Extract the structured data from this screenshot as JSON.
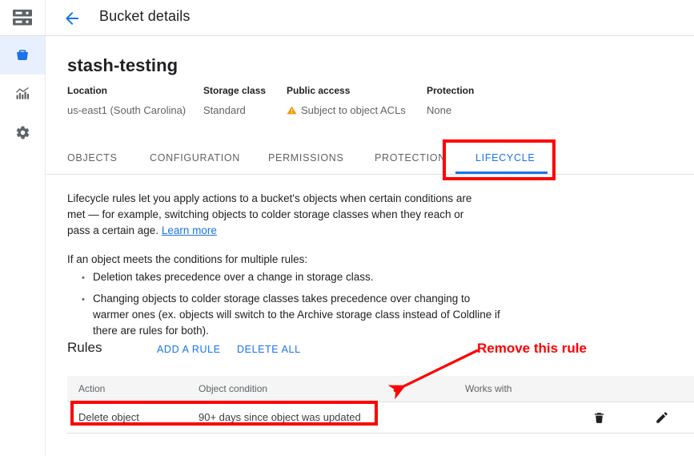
{
  "topbar": {
    "logo_icon": "storage-rack-icon",
    "back_icon": "back-arrow-icon",
    "title": "Bucket details"
  },
  "sidebar": {
    "items": [
      {
        "icon": "bucket-icon",
        "name": "buckets",
        "active": true
      },
      {
        "icon": "monitoring-chart-icon",
        "name": "monitoring",
        "active": false
      },
      {
        "icon": "gear-icon",
        "name": "settings",
        "active": false
      }
    ]
  },
  "bucket": {
    "name": "stash-testing",
    "meta": [
      {
        "label": "Location",
        "value": "us-east1 (South Carolina)",
        "warn": false
      },
      {
        "label": "Storage class",
        "value": "Standard",
        "warn": false
      },
      {
        "label": "Public access",
        "value": "Subject to object ACLs",
        "warn": true
      },
      {
        "label": "Protection",
        "value": "None",
        "warn": false
      }
    ]
  },
  "tabs": [
    {
      "label": "OBJECTS",
      "active": false
    },
    {
      "label": "CONFIGURATION",
      "active": false
    },
    {
      "label": "PERMISSIONS",
      "active": false
    },
    {
      "label": "PROTECTION",
      "active": false
    },
    {
      "label": "LIFECYCLE",
      "active": true
    }
  ],
  "lifecycle": {
    "intro_part1": "Lifecycle rules let you apply actions to a bucket's objects when certain conditions are met — for example, switching objects to colder storage classes when they reach or pass a certain age. ",
    "learn_more": "Learn more",
    "multi_rule_heading": "If an object meets the conditions for multiple rules:",
    "bullets": [
      "Deletion takes precedence over a change in storage class.",
      "Changing objects to colder storage classes takes precedence over changing to warmer ones (ex. objects will switch to the Archive storage class instead of Coldline if there are rules for both)."
    ]
  },
  "rules": {
    "title": "Rules",
    "add_label": "ADD A RULE",
    "delete_all_label": "DELETE ALL",
    "columns": [
      "Action",
      "Object condition",
      "Works with"
    ],
    "rows": [
      {
        "action": "Delete object",
        "object_condition": "90+ days since object was updated",
        "works_with": "",
        "delete_icon": "trash-icon",
        "edit_icon": "pencil-icon"
      }
    ]
  },
  "annotations": {
    "color": "#ff0000",
    "callout_text": "Remove this rule"
  }
}
